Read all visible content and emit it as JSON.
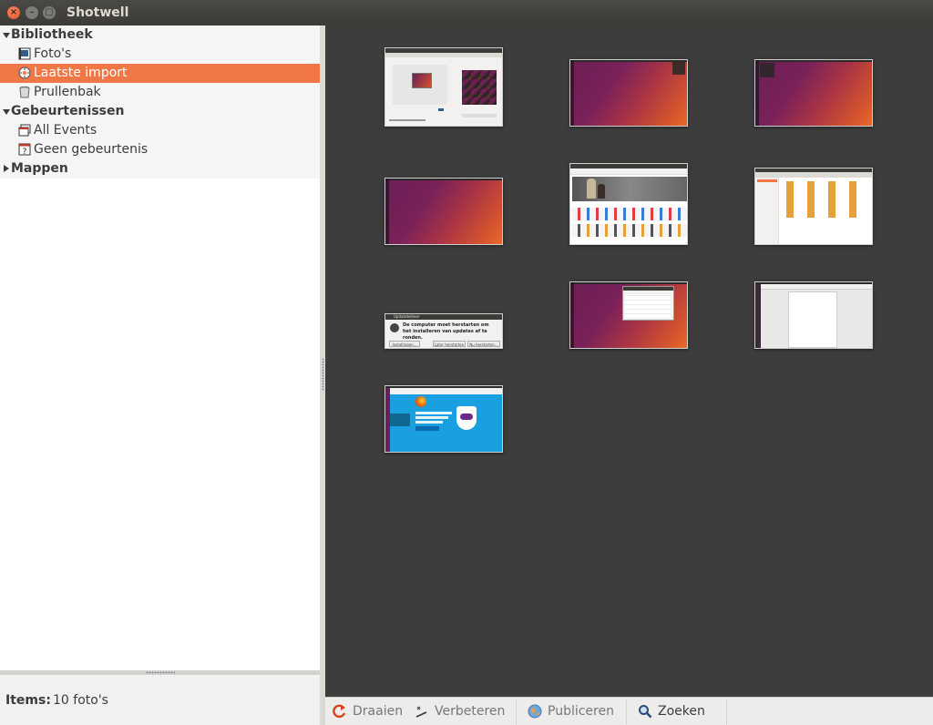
{
  "window": {
    "title": "Shotwell"
  },
  "sidebar": {
    "library_label": "Bibliotheek",
    "items": [
      {
        "label": "Foto's"
      },
      {
        "label": "Laatste import"
      },
      {
        "label": "Prullenbak"
      }
    ],
    "events_label": "Gebeurtenissen",
    "events": [
      {
        "label": "All Events"
      },
      {
        "label": "Geen gebeurtenis"
      }
    ],
    "folders_label": "Mappen",
    "selected": "Laatste import"
  },
  "status": {
    "label": "Items:",
    "value": "10 foto's"
  },
  "toolbar": {
    "rotate": "Draaien",
    "enhance": "Verbeteren",
    "publish": "Publiceren",
    "search": "Zoeken"
  },
  "thumbnails": [
    {
      "kind": "settings-window"
    },
    {
      "kind": "desktop"
    },
    {
      "kind": "desktop"
    },
    {
      "kind": "desktop"
    },
    {
      "kind": "software-center"
    },
    {
      "kind": "file-manager"
    },
    {
      "kind": "update-dialog",
      "title": "Updatebeheer",
      "message": "De computer moet herstarten om het installeren van updates af te ronden.",
      "buttons": [
        "Instellingen...",
        "Later herstarten",
        "Nu herstarten..."
      ]
    },
    {
      "kind": "desktop-window"
    },
    {
      "kind": "document-editor"
    },
    {
      "kind": "browser-firefox"
    }
  ],
  "colors": {
    "selection": "#f07746",
    "viewer_bg": "#3d3d3d"
  }
}
